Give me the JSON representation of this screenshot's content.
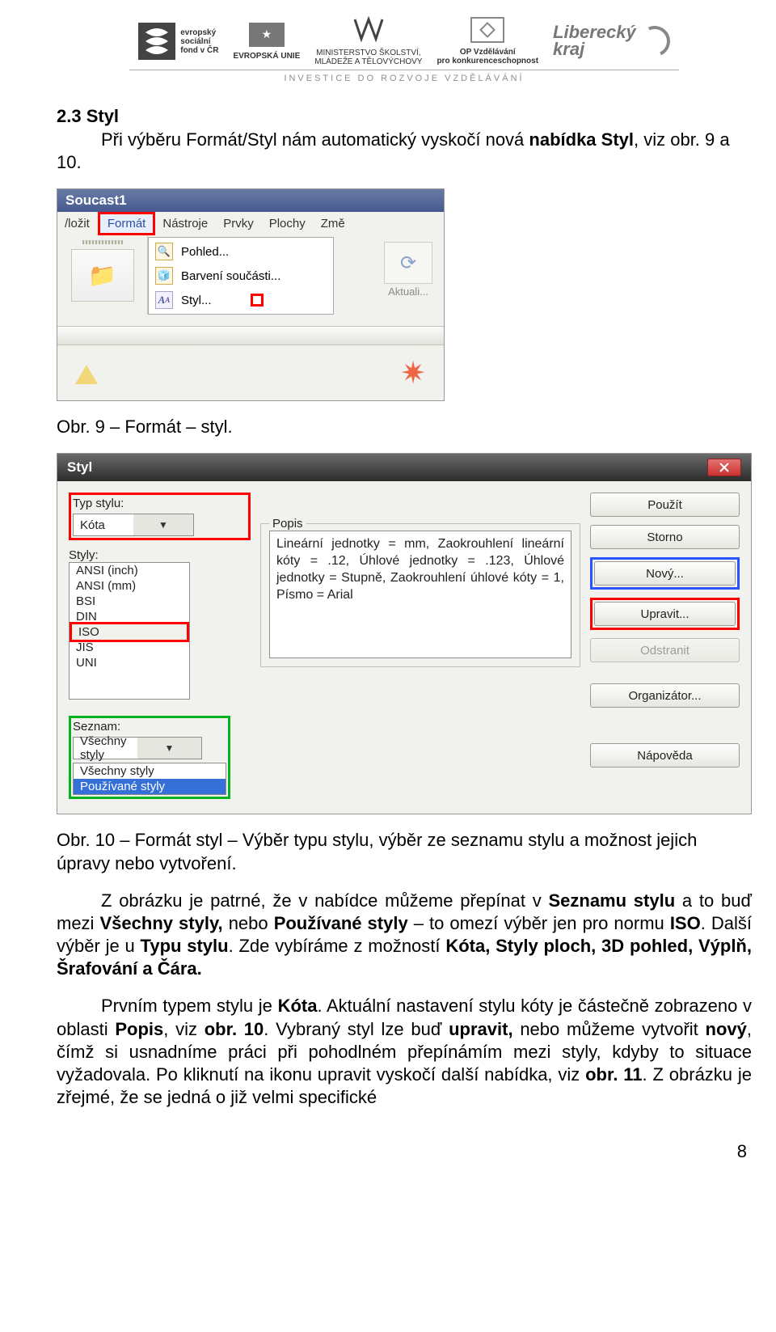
{
  "header": {
    "esf_small": "evropský\nsociální\nfond v ČR",
    "eu_label": "EVROPSKÁ UNIE",
    "msmt": "MINISTERSTVO ŠKOLSTVÍ,\nMLÁDEŽE A TĚLOVÝCHOVY",
    "opvk": "OP Vzdělávání\npro konkurenceschopnost",
    "kraj": "Liberecký\nkraj",
    "invest": "INVESTICE DO ROZVOJE VZDĚLÁVÁNÍ"
  },
  "section_title": "2.3 Styl",
  "para_intro_a": "Při výběru Formát/Styl nám automatický vyskočí nová ",
  "para_intro_b": "nabídka Styl",
  "para_intro_c": ", viz obr. 9 a 10.",
  "sc1": {
    "title": "Soucast1",
    "menu": [
      "/ložit",
      "Formát",
      "Nástroje",
      "Prvky",
      "Plochy",
      "Změ"
    ],
    "drop": {
      "pohled": "Pohled...",
      "barveni": "Barvení součásti...",
      "styl": "Styl..."
    },
    "akt": "Aktuali..."
  },
  "cap1": "Obr. 9 – Formát – styl.",
  "sc2": {
    "win_title": "Styl",
    "typ_label": "Typ stylu:",
    "typ_value": "Kóta",
    "styly_label": "Styly:",
    "styly_items": [
      "ANSI (inch)",
      "ANSI (mm)",
      "BSI",
      "DIN",
      "ISO",
      "JIS",
      "UNI"
    ],
    "popis_label": "Popis",
    "popis_text": "Lineární jednotky = mm, Zaokrouhlení lineární kóty = .12, Úhlové jednotky = .123, Úhlové jednotky = Stupně, Zaokrouhlení úhlové kóty = 1, Písmo = Arial",
    "btn_pouzit": "Použít",
    "btn_storno": "Storno",
    "btn_novy": "Nový...",
    "btn_upravit": "Upravit...",
    "btn_odstranit": "Odstranit",
    "btn_organizator": "Organizátor...",
    "btn_napoveda": "Nápověda",
    "seznam_label": "Seznam:",
    "seznam_value": "Všechny styly",
    "seznam_items": [
      "Všechny styly",
      "Používané styly"
    ]
  },
  "cap2": "Obr. 10 – Formát styl – Výběr typu stylu, výběr ze seznamu stylu a možnost jejich úpravy nebo vytvoření.",
  "para2": {
    "a": "Z obrázku je patrné, že v nabídce můžeme přepínat v ",
    "b": "Seznamu stylu",
    "c": " a to buď mezi ",
    "d": "Všechny styly,",
    "e": " nebo ",
    "f": "Používané styly",
    "g": " – to omezí výběr jen pro normu ",
    "h": "ISO",
    "i": ". Další výběr je u ",
    "j": "Typu stylu",
    "k": ". Zde vybíráme z možností ",
    "l": "Kóta, Styly ploch, 3D pohled, Výplň, Šrafování a Čára."
  },
  "para3": {
    "a": "Prvním typem stylu je ",
    "b": "Kóta",
    "c": ". Aktuální nastavení stylu kóty je částečně zobrazeno v oblasti ",
    "d": "Popis",
    "e": ", viz ",
    "f": "obr. 10",
    "g": ". Vybraný styl lze buď ",
    "h": "upravit,",
    "i": " nebo můžeme vytvořit ",
    "j": "nový",
    "k": ", čímž si usnadníme práci při pohodlném přepínámím mezi styly, kdyby to situace vyžadovala. Po kliknutí na ikonu upravit vyskočí další nabídka, viz ",
    "l": "obr. 11",
    "m": ". Z obrázku je zřejmé, že se jedná o již velmi specifické"
  },
  "pagenum": "8"
}
